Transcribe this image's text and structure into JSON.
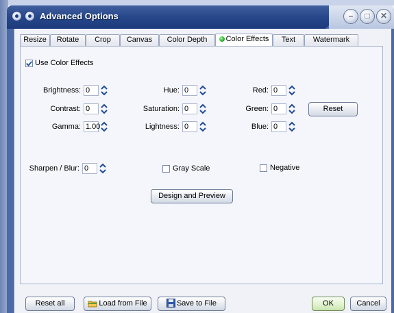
{
  "window": {
    "title": "Advanced Options"
  },
  "tabs": [
    {
      "label": "Resize"
    },
    {
      "label": "Rotate"
    },
    {
      "label": "Crop"
    },
    {
      "label": "Canvas"
    },
    {
      "label": "Color Depth"
    },
    {
      "label": "Color Effects"
    },
    {
      "label": "Text"
    },
    {
      "label": "Watermark"
    }
  ],
  "active_tab": "Color Effects",
  "color_effects": {
    "use_color_effects": {
      "label": "Use Color Effects",
      "checked": true
    },
    "brightness": {
      "label": "Brightness:",
      "value": "0"
    },
    "contrast": {
      "label": "Contrast:",
      "value": "0"
    },
    "gamma": {
      "label": "Gamma:",
      "value": "1.00"
    },
    "hue": {
      "label": "Hue:",
      "value": "0"
    },
    "saturation": {
      "label": "Saturation:",
      "value": "0"
    },
    "lightness": {
      "label": "Lightness:",
      "value": "0"
    },
    "red": {
      "label": "Red:",
      "value": "0"
    },
    "green": {
      "label": "Green:",
      "value": "0"
    },
    "blue": {
      "label": "Blue:",
      "value": "0"
    },
    "reset_label": "Reset",
    "sharpen_blur": {
      "label": "Sharpen / Blur:",
      "value": "0"
    },
    "gray_scale": {
      "label": "Gray Scale",
      "checked": false
    },
    "negative": {
      "label": "Negative",
      "checked": false
    },
    "design_preview_label": "Design and Preview"
  },
  "footer": {
    "reset_all_label": "Reset all",
    "load_label": "Load from File",
    "save_label": "Save to File",
    "ok_label": "OK",
    "cancel_label": "Cancel"
  },
  "colors": {
    "titlebar": "#27478a",
    "active_tab_dot": "#1ea41e"
  }
}
